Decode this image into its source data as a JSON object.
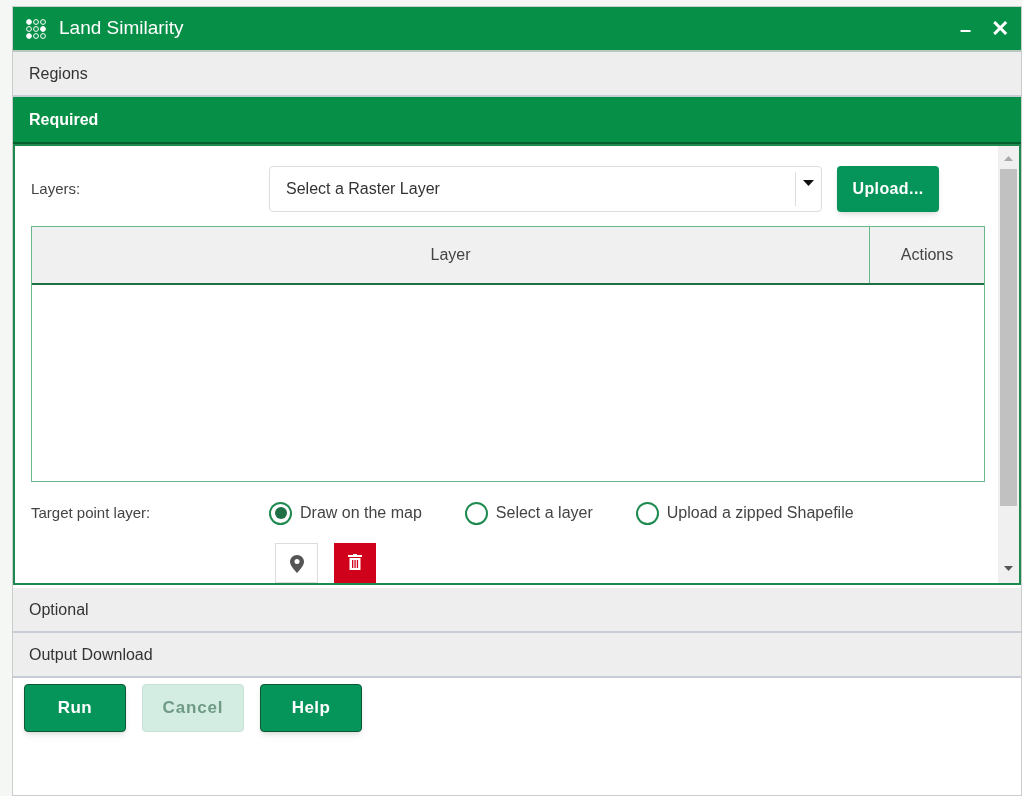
{
  "window": {
    "title": "Land Similarity",
    "minimize": "–",
    "close": "✕"
  },
  "sections": [
    {
      "label": "Regions",
      "expanded": false
    },
    {
      "label": "Required",
      "expanded": true
    },
    {
      "label": "Optional",
      "expanded": false
    },
    {
      "label": "Output Download",
      "expanded": false
    }
  ],
  "required": {
    "layers_label": "Layers:",
    "layer_select": {
      "placeholder": "Select a Raster Layer"
    },
    "upload_button": "Upload...",
    "table": {
      "columns": [
        "Layer",
        "Actions"
      ]
    },
    "target_label": "Target point layer:",
    "target_options": [
      {
        "label": "Draw on the map",
        "selected": true
      },
      {
        "label": "Select a layer",
        "selected": false
      },
      {
        "label": "Upload a zipped Shapefile",
        "selected": false
      }
    ]
  },
  "buttons": [
    {
      "label": "Run",
      "disabled": false
    },
    {
      "label": "Cancel",
      "disabled": true
    },
    {
      "label": "Help",
      "disabled": false
    }
  ]
}
